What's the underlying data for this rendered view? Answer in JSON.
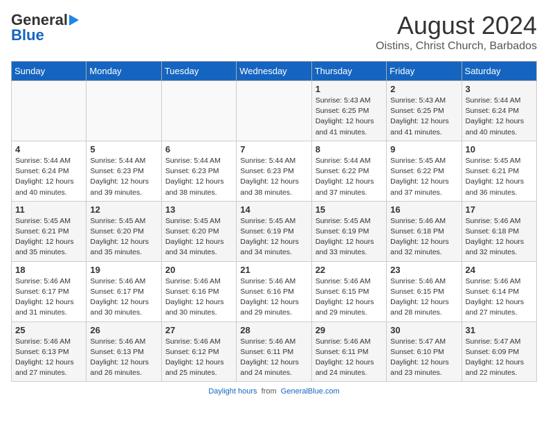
{
  "header": {
    "logo_general": "General",
    "logo_blue": "Blue",
    "month_title": "August 2024",
    "location": "Oistins, Christ Church, Barbados"
  },
  "weekdays": [
    "Sunday",
    "Monday",
    "Tuesday",
    "Wednesday",
    "Thursday",
    "Friday",
    "Saturday"
  ],
  "weeks": [
    [
      {
        "day": "",
        "info": ""
      },
      {
        "day": "",
        "info": ""
      },
      {
        "day": "",
        "info": ""
      },
      {
        "day": "",
        "info": ""
      },
      {
        "day": "1",
        "info": "Sunrise: 5:43 AM\nSunset: 6:25 PM\nDaylight: 12 hours\nand 41 minutes."
      },
      {
        "day": "2",
        "info": "Sunrise: 5:43 AM\nSunset: 6:25 PM\nDaylight: 12 hours\nand 41 minutes."
      },
      {
        "day": "3",
        "info": "Sunrise: 5:44 AM\nSunset: 6:24 PM\nDaylight: 12 hours\nand 40 minutes."
      }
    ],
    [
      {
        "day": "4",
        "info": "Sunrise: 5:44 AM\nSunset: 6:24 PM\nDaylight: 12 hours\nand 40 minutes."
      },
      {
        "day": "5",
        "info": "Sunrise: 5:44 AM\nSunset: 6:23 PM\nDaylight: 12 hours\nand 39 minutes."
      },
      {
        "day": "6",
        "info": "Sunrise: 5:44 AM\nSunset: 6:23 PM\nDaylight: 12 hours\nand 38 minutes."
      },
      {
        "day": "7",
        "info": "Sunrise: 5:44 AM\nSunset: 6:23 PM\nDaylight: 12 hours\nand 38 minutes."
      },
      {
        "day": "8",
        "info": "Sunrise: 5:44 AM\nSunset: 6:22 PM\nDaylight: 12 hours\nand 37 minutes."
      },
      {
        "day": "9",
        "info": "Sunrise: 5:45 AM\nSunset: 6:22 PM\nDaylight: 12 hours\nand 37 minutes."
      },
      {
        "day": "10",
        "info": "Sunrise: 5:45 AM\nSunset: 6:21 PM\nDaylight: 12 hours\nand 36 minutes."
      }
    ],
    [
      {
        "day": "11",
        "info": "Sunrise: 5:45 AM\nSunset: 6:21 PM\nDaylight: 12 hours\nand 35 minutes."
      },
      {
        "day": "12",
        "info": "Sunrise: 5:45 AM\nSunset: 6:20 PM\nDaylight: 12 hours\nand 35 minutes."
      },
      {
        "day": "13",
        "info": "Sunrise: 5:45 AM\nSunset: 6:20 PM\nDaylight: 12 hours\nand 34 minutes."
      },
      {
        "day": "14",
        "info": "Sunrise: 5:45 AM\nSunset: 6:19 PM\nDaylight: 12 hours\nand 34 minutes."
      },
      {
        "day": "15",
        "info": "Sunrise: 5:45 AM\nSunset: 6:19 PM\nDaylight: 12 hours\nand 33 minutes."
      },
      {
        "day": "16",
        "info": "Sunrise: 5:46 AM\nSunset: 6:18 PM\nDaylight: 12 hours\nand 32 minutes."
      },
      {
        "day": "17",
        "info": "Sunrise: 5:46 AM\nSunset: 6:18 PM\nDaylight: 12 hours\nand 32 minutes."
      }
    ],
    [
      {
        "day": "18",
        "info": "Sunrise: 5:46 AM\nSunset: 6:17 PM\nDaylight: 12 hours\nand 31 minutes."
      },
      {
        "day": "19",
        "info": "Sunrise: 5:46 AM\nSunset: 6:17 PM\nDaylight: 12 hours\nand 30 minutes."
      },
      {
        "day": "20",
        "info": "Sunrise: 5:46 AM\nSunset: 6:16 PM\nDaylight: 12 hours\nand 30 minutes."
      },
      {
        "day": "21",
        "info": "Sunrise: 5:46 AM\nSunset: 6:16 PM\nDaylight: 12 hours\nand 29 minutes."
      },
      {
        "day": "22",
        "info": "Sunrise: 5:46 AM\nSunset: 6:15 PM\nDaylight: 12 hours\nand 29 minutes."
      },
      {
        "day": "23",
        "info": "Sunrise: 5:46 AM\nSunset: 6:15 PM\nDaylight: 12 hours\nand 28 minutes."
      },
      {
        "day": "24",
        "info": "Sunrise: 5:46 AM\nSunset: 6:14 PM\nDaylight: 12 hours\nand 27 minutes."
      }
    ],
    [
      {
        "day": "25",
        "info": "Sunrise: 5:46 AM\nSunset: 6:13 PM\nDaylight: 12 hours\nand 27 minutes."
      },
      {
        "day": "26",
        "info": "Sunrise: 5:46 AM\nSunset: 6:13 PM\nDaylight: 12 hours\nand 26 minutes."
      },
      {
        "day": "27",
        "info": "Sunrise: 5:46 AM\nSunset: 6:12 PM\nDaylight: 12 hours\nand 25 minutes."
      },
      {
        "day": "28",
        "info": "Sunrise: 5:46 AM\nSunset: 6:11 PM\nDaylight: 12 hours\nand 24 minutes."
      },
      {
        "day": "29",
        "info": "Sunrise: 5:46 AM\nSunset: 6:11 PM\nDaylight: 12 hours\nand 24 minutes."
      },
      {
        "day": "30",
        "info": "Sunrise: 5:47 AM\nSunset: 6:10 PM\nDaylight: 12 hours\nand 23 minutes."
      },
      {
        "day": "31",
        "info": "Sunrise: 5:47 AM\nSunset: 6:09 PM\nDaylight: 12 hours\nand 22 minutes."
      }
    ]
  ],
  "footer": {
    "label": "Daylight hours",
    "source": "GeneralBlue.com"
  }
}
